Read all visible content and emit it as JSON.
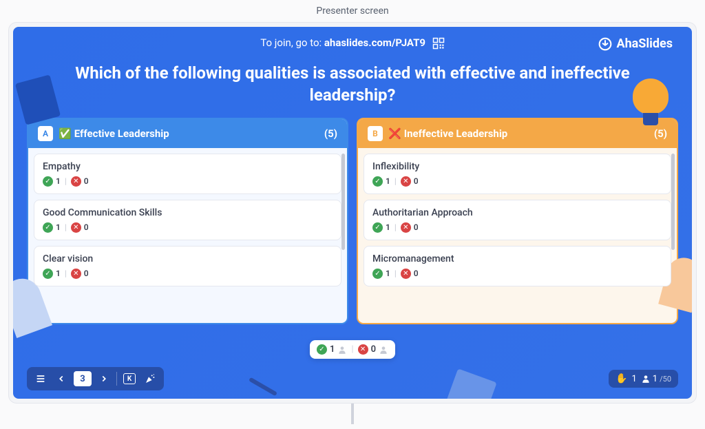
{
  "screen_label": "Presenter screen",
  "join": {
    "prefix": "To join, go to:",
    "url": "ahaslides.com/PJAT9"
  },
  "brand": "AhaSlides",
  "question": "Which of the following qualities is associated with effective and ineffective leadership?",
  "columns": {
    "a": {
      "letter": "A",
      "emoji": "✅",
      "title": "Effective Leadership",
      "count": "(5)",
      "cards": [
        {
          "title": "Empathy",
          "ok": "1",
          "no": "0"
        },
        {
          "title": "Good Communication Skills",
          "ok": "1",
          "no": "0"
        },
        {
          "title": "Clear vision",
          "ok": "1",
          "no": "0"
        }
      ]
    },
    "b": {
      "letter": "B",
      "emoji": "❌",
      "title": "Ineffective Leadership",
      "count": "(5)",
      "cards": [
        {
          "title": "Inflexibility",
          "ok": "1",
          "no": "0"
        },
        {
          "title": "Authoritarian Approach",
          "ok": "1",
          "no": "0"
        },
        {
          "title": "Micromanagement",
          "ok": "1",
          "no": "0"
        }
      ]
    }
  },
  "center_pill": {
    "ok": "1",
    "no": "0"
  },
  "nav": {
    "page": "3"
  },
  "status": {
    "raised": "1",
    "present": "1",
    "total": "/50"
  }
}
